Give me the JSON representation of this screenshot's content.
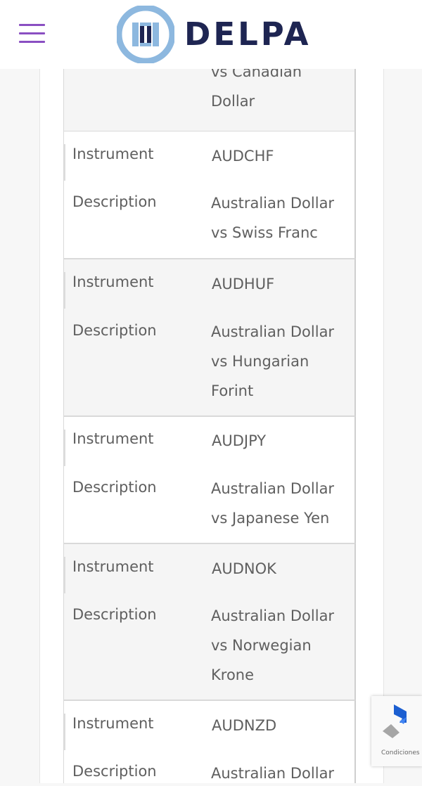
{
  "header": {
    "brand": "DELPA",
    "menu_icon": "hamburger-menu-icon"
  },
  "table": {
    "top_partial": {
      "value_line1": "vs Canadian",
      "value_line2": "Dollar"
    },
    "rows": [
      {
        "label_instrument": "Instrument",
        "instrument": "AUDCHF",
        "label_description": "Description",
        "desc_lines": [
          "Australian Dollar",
          "vs Swiss Franc"
        ]
      },
      {
        "label_instrument": "Instrument",
        "instrument": "AUDHUF",
        "label_description": "Description",
        "desc_lines": [
          "Australian Dollar",
          "vs Hungarian",
          "Forint"
        ]
      },
      {
        "label_instrument": "Instrument",
        "instrument": "AUDJPY",
        "label_description": "Description",
        "desc_lines": [
          "Australian Dollar",
          "vs Japanese Yen"
        ]
      },
      {
        "label_instrument": "Instrument",
        "instrument": "AUDNOK",
        "label_description": "Description",
        "desc_lines": [
          "Australian Dollar",
          "vs Norwegian",
          "Krone"
        ]
      },
      {
        "label_instrument": "Instrument",
        "instrument": "AUDNZD",
        "label_description": "Description",
        "desc_lines": [
          "Australian Dollar"
        ]
      }
    ]
  },
  "recaptcha": {
    "label": "Condiciones",
    "icon": "recaptcha-icon"
  },
  "colors": {
    "menu": "#8a4fc2",
    "brand_text": "#1e2552",
    "logo_blue": "#8db8df",
    "row_shade": "#f5f5f5"
  }
}
